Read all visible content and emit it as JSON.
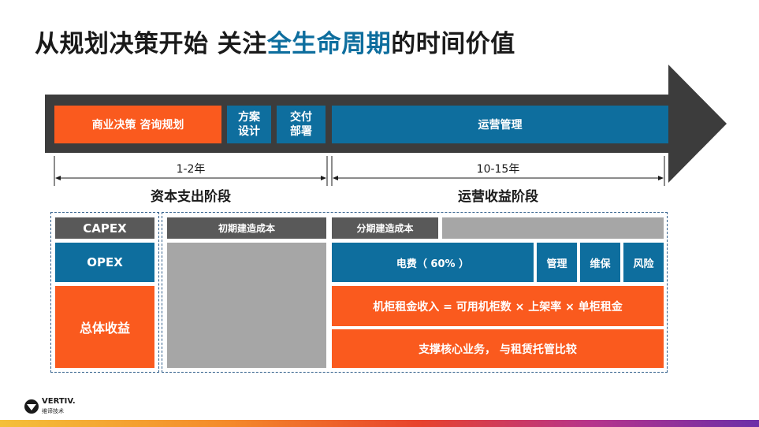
{
  "title": {
    "part1": "从规划决策开始  关注",
    "highlight": "全生命周期",
    "part2": "的时间价值"
  },
  "arrow_stages": {
    "business": "商业决策 咨询规划",
    "design_line1": "方案",
    "design_line2": "设计",
    "delivery_line1": "交付",
    "delivery_line2": "部署",
    "operations": "运营管理"
  },
  "timeline": {
    "left_duration": "1-2年",
    "right_duration": "10-15年",
    "left_phase": "资本支出阶段",
    "right_phase": "运营收益阶段"
  },
  "legend": {
    "capex": "CAPEX",
    "opex": "OPEX",
    "total": "总体收益"
  },
  "matrix": {
    "initial_build": "初期建造成本",
    "phased_build": "分期建造成本",
    "electricity": "电费（ 60% ）",
    "management": "管理",
    "maintenance": "维保",
    "risk": "风险",
    "rack_revenue": "机柜租金收入 = 可用机柜数 × 上架率 × 单柜租金",
    "core_business": "支撑核心业务， 与租赁托管比较"
  },
  "logo": {
    "brand": "VERTIV.",
    "sub": "维谛技术"
  },
  "colors": {
    "orange": "#fa5a1e",
    "blue": "#0e6e9e",
    "dark_gray": "#595959",
    "light_gray": "#a6a6a6",
    "arrow": "#3c3c3c"
  }
}
